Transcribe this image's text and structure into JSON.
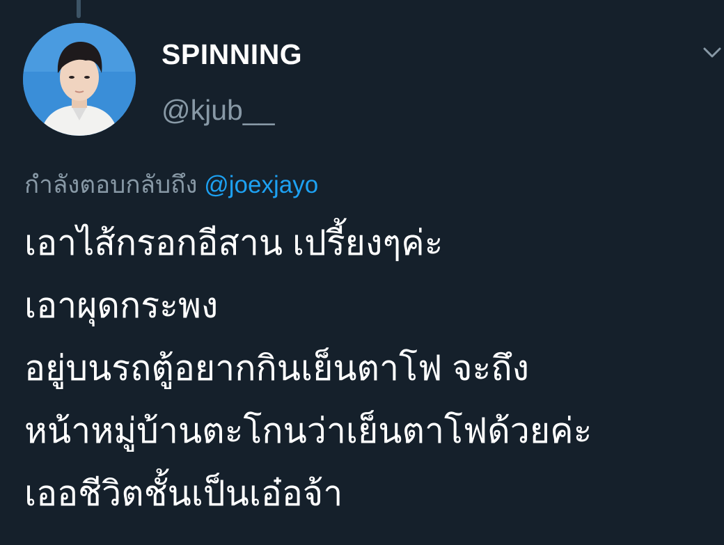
{
  "tweet": {
    "author": {
      "display_name": "SPINNING",
      "handle": "@kjub__",
      "avatar_icon": "profile-photo"
    },
    "menu_icon": "chevron-down-icon",
    "reply_context": {
      "prefix": "กำลังตอบกลับถึง",
      "mention": "@joexjayo"
    },
    "text_lines": [
      "เอาไส้กรอกอีสาน เปรี้ยงๆค่ะ",
      "เอาผุดกระพง",
      "อยู่บนรถตู้อยากกินเย็นตาโฟ จะถึง",
      "หน้าหมู่บ้านตะโกนว่าเย็นตาโฟด้วยค่ะ",
      "เออชีวิตชั้นเป็นเอ๋อจ้า"
    ]
  },
  "colors": {
    "background": "#15202b",
    "primary_text": "#ffffff",
    "secondary_text": "#8899a6",
    "link": "#1da1f2",
    "thread_line": "#3d5466"
  }
}
